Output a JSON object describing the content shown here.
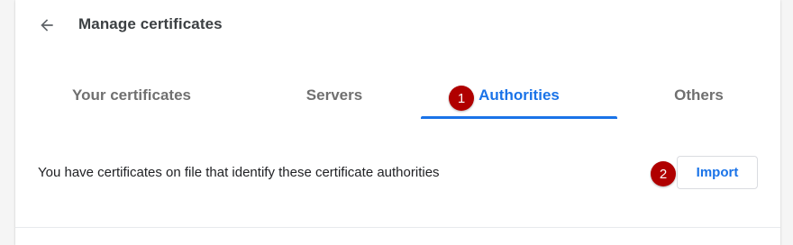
{
  "header": {
    "back_icon": "arrow-back-icon",
    "title": "Manage certificates"
  },
  "tabs": [
    {
      "label": "Your certificates",
      "selected": false
    },
    {
      "label": "Servers",
      "selected": false
    },
    {
      "label": "Authorities",
      "selected": true
    },
    {
      "label": "Others",
      "selected": false
    }
  ],
  "markers": [
    {
      "label": "1"
    },
    {
      "label": "2"
    }
  ],
  "content": {
    "description": "You have certificates on file that identify these certificate authorities",
    "import_label": "Import"
  },
  "colors": {
    "accent": "#1a73e8",
    "marker": "#b00000",
    "tab_inactive": "#707070"
  }
}
